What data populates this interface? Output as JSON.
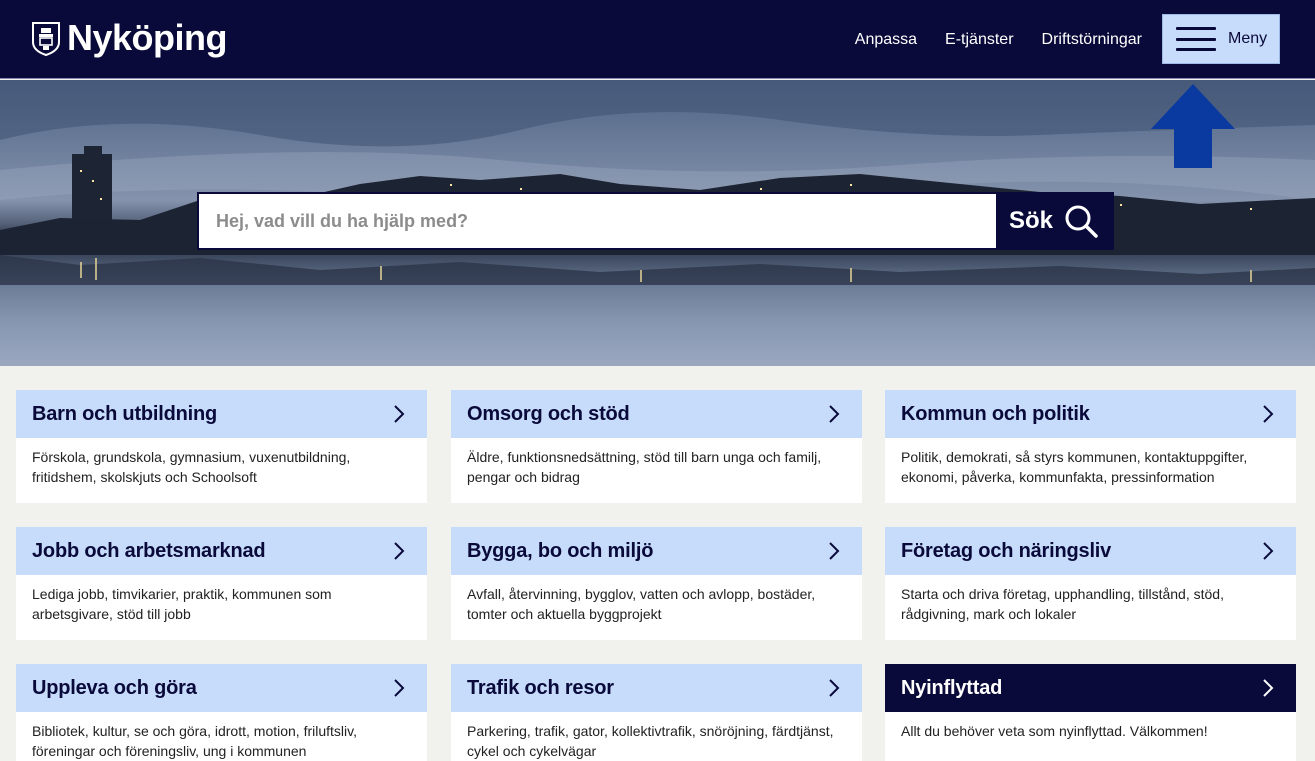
{
  "header": {
    "logo_text": "Nyköping",
    "nav": [
      "Anpassa",
      "E-tjänster",
      "Driftstörningar"
    ],
    "menu_label": "Meny"
  },
  "search": {
    "placeholder": "Hej, vad vill du ha hjälp med?",
    "button_label": "Sök"
  },
  "colors": {
    "navy": "#0a0a3a",
    "light_blue": "#c7dcfb",
    "arrow_blue": "#0a3aa0"
  },
  "cards": [
    {
      "title": "Barn och utbildning",
      "desc": "Förskola, grundskola, gymnasium, vuxenutbildning, fritidshem, skolskjuts och Schoolsoft"
    },
    {
      "title": "Omsorg och stöd",
      "desc": "Äldre, funktionsnedsättning, stöd till barn unga och familj, pengar och bidrag"
    },
    {
      "title": "Kommun och politik",
      "desc": "Politik, demokrati, så styrs kommunen, kontaktuppgifter, ekonomi, påverka, kommunfakta, pressinformation"
    },
    {
      "title": "Jobb och arbetsmarknad",
      "desc": "Lediga jobb, timvikarier, praktik, kommunen som arbetsgivare, stöd till jobb"
    },
    {
      "title": "Bygga, bo och miljö",
      "desc": "Avfall, återvinning, bygglov, vatten och avlopp, bostäder, tomter och aktuella byggprojekt"
    },
    {
      "title": "Företag och näringsliv",
      "desc": "Starta och driva företag, upphandling, tillstånd, stöd, rådgivning, mark och lokaler"
    },
    {
      "title": "Uppleva och göra",
      "desc": "Bibliotek, kultur, se och göra, idrott, motion, friluftsliv, föreningar och föreningsliv, ung i kommunen"
    },
    {
      "title": "Trafik och resor",
      "desc": "Parkering, trafik, gator, kollektivtrafik, snöröjning, färdtjänst, cykel och cykelvägar"
    },
    {
      "title": "Nyinflyttad",
      "desc": "Allt du behöver veta som nyinflyttad. Välkommen!"
    }
  ]
}
